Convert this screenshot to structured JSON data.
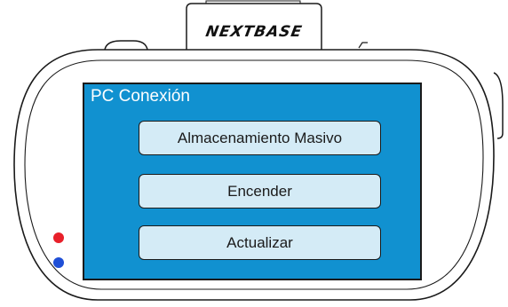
{
  "device": {
    "brand": "NEXTBASE"
  },
  "screen": {
    "title": "PC Conexión",
    "background_color": "#1191d0",
    "buttons": [
      {
        "label": "Almacenamiento Masivo"
      },
      {
        "label": "Encender"
      },
      {
        "label": "Actualizar"
      }
    ]
  },
  "indicators": {
    "red_led_color": "#e8202a",
    "blue_led_color": "#1f4fd6"
  }
}
